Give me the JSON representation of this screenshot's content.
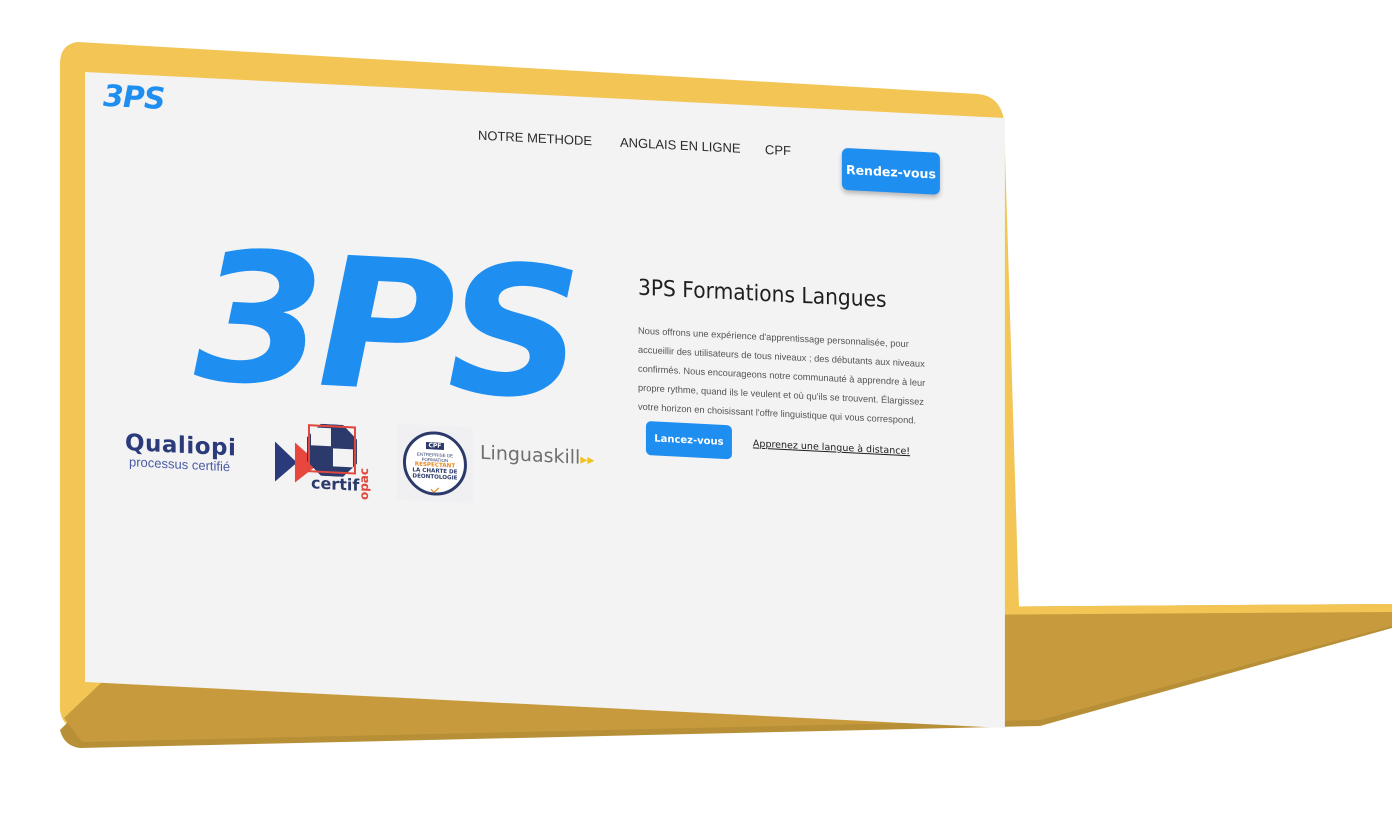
{
  "colors": {
    "laptop_body": "#f2c555",
    "laptop_shadow": "#b78f37",
    "screen_bg": "#f3f3f4",
    "brand_blue": "#1f8ef1"
  },
  "nav": {
    "logo": "3PS",
    "links": [
      "NOTRE METHODE",
      "ANGLAIS EN LIGNE",
      "CPF"
    ],
    "cta": "Rendez-vous"
  },
  "hero": {
    "big_logo": "3PS",
    "title": "3PS Formations Langues",
    "text": "Nous offrons une expérience d'apprentissage personnalisée, pour accueillir des utilisateurs de tous niveaux ; des débutants aux niveaux confirmés. Nous encourageons notre communauté à apprendre à leur propre rythme, quand ils le veulent et où qu'ils se trouvent. Élargissez votre horizon en choisissant l'offre linguistique qui vous correspond.",
    "primary_button": "Lancez-vous",
    "secondary_link": "Apprenez une langue à distance!"
  },
  "certifications": {
    "qualiopi": {
      "name": "Qualiopi",
      "subtitle": "processus certifié"
    },
    "certifopac": {
      "left": "certif",
      "right": "opac"
    },
    "cpf": {
      "tag": "CPF",
      "line1": "ENTREPRISE DE FORMATION",
      "line2": "RESPECTANT",
      "line3": "LA CHARTE DE",
      "line4": "DÉONTOLOGIE"
    },
    "linguaskill": {
      "name": "Linguaskill",
      "arrow": "▸▸"
    }
  }
}
